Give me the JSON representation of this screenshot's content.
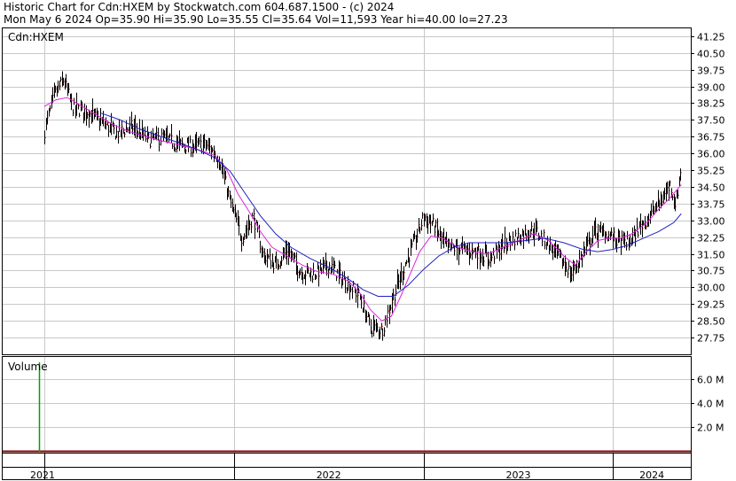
{
  "header": {
    "line1": "Historic Chart for Cdn:HXEM by Stockwatch.com 604.687.1500 - (c) 2024",
    "line2": "Mon May  6 2024  Op=35.90  Hi=35.90  Lo=35.55  Cl=35.64  Vol=11,593  Year hi=40.00  lo=27.23"
  },
  "colors": {
    "candle": "#8b0000",
    "ma_short": "#e020e0",
    "ma_long": "#2020c0",
    "volume": "#00a000",
    "grid": "#c8c8c8"
  },
  "chart_data": {
    "type": "line",
    "symbol_label": "Cdn:HXEM",
    "y_ticks": [
      "41.25",
      "40.50",
      "39.75",
      "39.00",
      "38.25",
      "37.50",
      "36.75",
      "36.00",
      "35.25",
      "34.50",
      "33.75",
      "33.00",
      "32.25",
      "31.50",
      "30.75",
      "30.00",
      "29.25",
      "28.50",
      "27.75"
    ],
    "ylim": [
      27.0,
      41.6
    ],
    "x_labels": [
      "2021",
      "2022",
      "2023",
      "2024"
    ],
    "series": [
      {
        "values": [
          [
            2021.0,
            37.0
          ],
          [
            2021.05,
            38.6
          ],
          [
            2021.1,
            39.3
          ],
          [
            2021.15,
            38.0
          ],
          [
            2021.22,
            37.9
          ],
          [
            2021.3,
            37.4
          ],
          [
            2021.38,
            36.9
          ],
          [
            2021.46,
            37.2
          ],
          [
            2021.55,
            36.6
          ],
          [
            2021.62,
            36.7
          ],
          [
            2021.7,
            36.4
          ],
          [
            2021.78,
            36.3
          ],
          [
            2021.85,
            36.4
          ],
          [
            2021.92,
            35.8
          ],
          [
            2021.98,
            33.8
          ],
          [
            2022.04,
            32.2
          ],
          [
            2022.1,
            33.2
          ],
          [
            2022.15,
            31.5
          ],
          [
            2022.22,
            31.0
          ],
          [
            2022.28,
            31.7
          ],
          [
            2022.35,
            30.7
          ],
          [
            2022.42,
            30.6
          ],
          [
            2022.5,
            31.0
          ],
          [
            2022.58,
            30.3
          ],
          [
            2022.66,
            29.6
          ],
          [
            2022.72,
            28.2
          ],
          [
            2022.78,
            28.1
          ],
          [
            2022.84,
            29.6
          ],
          [
            2022.9,
            31.0
          ],
          [
            2022.95,
            32.0
          ],
          [
            2023.0,
            33.2
          ],
          [
            2023.05,
            32.8
          ],
          [
            2023.12,
            31.8
          ],
          [
            2023.2,
            31.7
          ],
          [
            2023.28,
            31.6
          ],
          [
            2023.35,
            31.3
          ],
          [
            2023.42,
            31.9
          ],
          [
            2023.5,
            32.3
          ],
          [
            2023.58,
            32.6
          ],
          [
            2023.65,
            32.0
          ],
          [
            2023.72,
            31.3
          ],
          [
            2023.78,
            30.6
          ],
          [
            2023.84,
            31.5
          ],
          [
            2023.9,
            32.5
          ],
          [
            2023.96,
            32.4
          ],
          [
            2024.02,
            32.1
          ],
          [
            2024.08,
            32.0
          ],
          [
            2024.14,
            32.7
          ],
          [
            2024.2,
            33.3
          ],
          [
            2024.26,
            34.0
          ],
          [
            2024.3,
            34.6
          ],
          [
            2024.33,
            33.7
          ],
          [
            2024.36,
            35.6
          ]
        ]
      },
      {
        "values": [
          [
            2021.0,
            38.1
          ],
          [
            2021.06,
            38.4
          ],
          [
            2021.12,
            38.5
          ],
          [
            2021.2,
            38.1
          ],
          [
            2021.28,
            37.7
          ],
          [
            2021.36,
            37.3
          ],
          [
            2021.44,
            37.0
          ],
          [
            2021.52,
            36.8
          ],
          [
            2021.6,
            36.6
          ],
          [
            2021.7,
            36.4
          ],
          [
            2021.8,
            36.2
          ],
          [
            2021.9,
            35.9
          ],
          [
            2021.96,
            35.3
          ],
          [
            2022.02,
            34.2
          ],
          [
            2022.08,
            33.4
          ],
          [
            2022.14,
            32.5
          ],
          [
            2022.2,
            31.8
          ],
          [
            2022.28,
            31.4
          ],
          [
            2022.36,
            31.0
          ],
          [
            2022.44,
            30.7
          ],
          [
            2022.52,
            30.6
          ],
          [
            2022.6,
            30.3
          ],
          [
            2022.66,
            29.8
          ],
          [
            2022.72,
            29.0
          ],
          [
            2022.78,
            28.5
          ],
          [
            2022.83,
            28.7
          ],
          [
            2022.88,
            29.6
          ],
          [
            2022.93,
            30.6
          ],
          [
            2022.98,
            31.6
          ],
          [
            2023.04,
            32.3
          ],
          [
            2023.1,
            32.2
          ],
          [
            2023.18,
            31.8
          ],
          [
            2023.26,
            31.6
          ],
          [
            2023.34,
            31.5
          ],
          [
            2023.42,
            31.8
          ],
          [
            2023.5,
            32.1
          ],
          [
            2023.58,
            32.4
          ],
          [
            2023.66,
            32.1
          ],
          [
            2023.74,
            31.4
          ],
          [
            2023.8,
            31.0
          ],
          [
            2023.86,
            31.6
          ],
          [
            2023.92,
            32.1
          ],
          [
            2023.98,
            32.2
          ],
          [
            2024.04,
            32.2
          ],
          [
            2024.1,
            32.4
          ],
          [
            2024.18,
            32.9
          ],
          [
            2024.24,
            33.5
          ],
          [
            2024.3,
            34.0
          ],
          [
            2024.34,
            34.4
          ],
          [
            2024.36,
            34.6
          ]
        ]
      },
      {
        "values": [
          [
            2021.3,
            37.8
          ],
          [
            2021.4,
            37.5
          ],
          [
            2021.5,
            37.1
          ],
          [
            2021.6,
            36.8
          ],
          [
            2021.7,
            36.5
          ],
          [
            2021.8,
            36.2
          ],
          [
            2021.9,
            35.8
          ],
          [
            2021.98,
            35.2
          ],
          [
            2022.06,
            34.2
          ],
          [
            2022.14,
            33.2
          ],
          [
            2022.22,
            32.4
          ],
          [
            2022.3,
            31.8
          ],
          [
            2022.4,
            31.3
          ],
          [
            2022.5,
            30.9
          ],
          [
            2022.6,
            30.4
          ],
          [
            2022.68,
            29.9
          ],
          [
            2022.76,
            29.6
          ],
          [
            2022.84,
            29.6
          ],
          [
            2022.92,
            30.1
          ],
          [
            2023.0,
            30.8
          ],
          [
            2023.08,
            31.4
          ],
          [
            2023.16,
            31.8
          ],
          [
            2023.24,
            32.0
          ],
          [
            2023.34,
            32.0
          ],
          [
            2023.44,
            32.0
          ],
          [
            2023.54,
            32.1
          ],
          [
            2023.64,
            32.2
          ],
          [
            2023.74,
            32.0
          ],
          [
            2023.84,
            31.7
          ],
          [
            2023.92,
            31.6
          ],
          [
            2024.0,
            31.7
          ],
          [
            2024.08,
            31.9
          ],
          [
            2024.16,
            32.2
          ],
          [
            2024.24,
            32.5
          ],
          [
            2024.32,
            32.9
          ],
          [
            2024.36,
            33.3
          ]
        ]
      }
    ],
    "volume": {
      "label": "Volume",
      "y_ticks": [
        "6.0 M",
        "4.0 M",
        "2.0 M"
      ],
      "ylim": [
        0,
        7.4
      ],
      "spike": {
        "x": 2020.97,
        "value": 7.4
      }
    }
  }
}
